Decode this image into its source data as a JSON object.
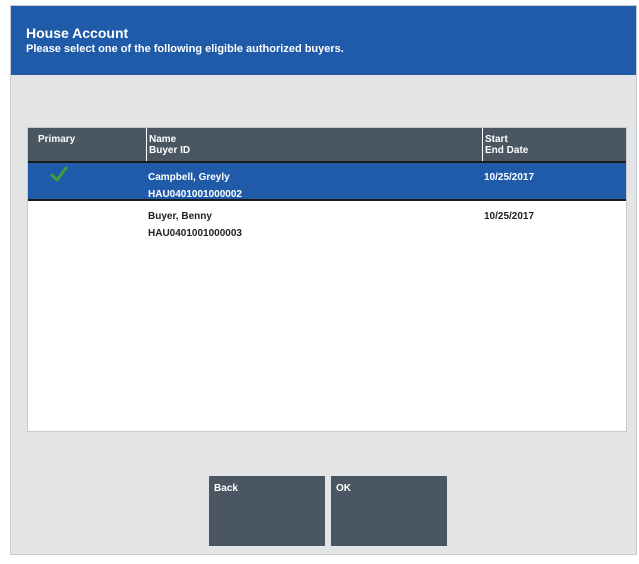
{
  "header": {
    "title": "House Account",
    "subtitle": "Please select one of the following eligible authorized buyers."
  },
  "table": {
    "columns": {
      "primary": "Primary",
      "name_line1": "Name",
      "name_line2": "Buyer ID",
      "date_line1": "Start",
      "date_line2": "End Date"
    },
    "rows": [
      {
        "primary": true,
        "name": "Campbell, Greyly",
        "buyer_id": "HAU0401001000002",
        "start_date": "10/25/2017",
        "selected": true
      },
      {
        "primary": false,
        "name": "Buyer, Benny",
        "buyer_id": "HAU0401001000003",
        "start_date": "10/25/2017",
        "selected": false
      }
    ]
  },
  "buttons": {
    "back_label": "Back",
    "ok_label": "OK"
  },
  "colors": {
    "accent": "#1f5ba8",
    "header_dark": "#4a5661",
    "check": "#3aa03a"
  },
  "icons": {
    "primary_marker": "check-icon"
  }
}
